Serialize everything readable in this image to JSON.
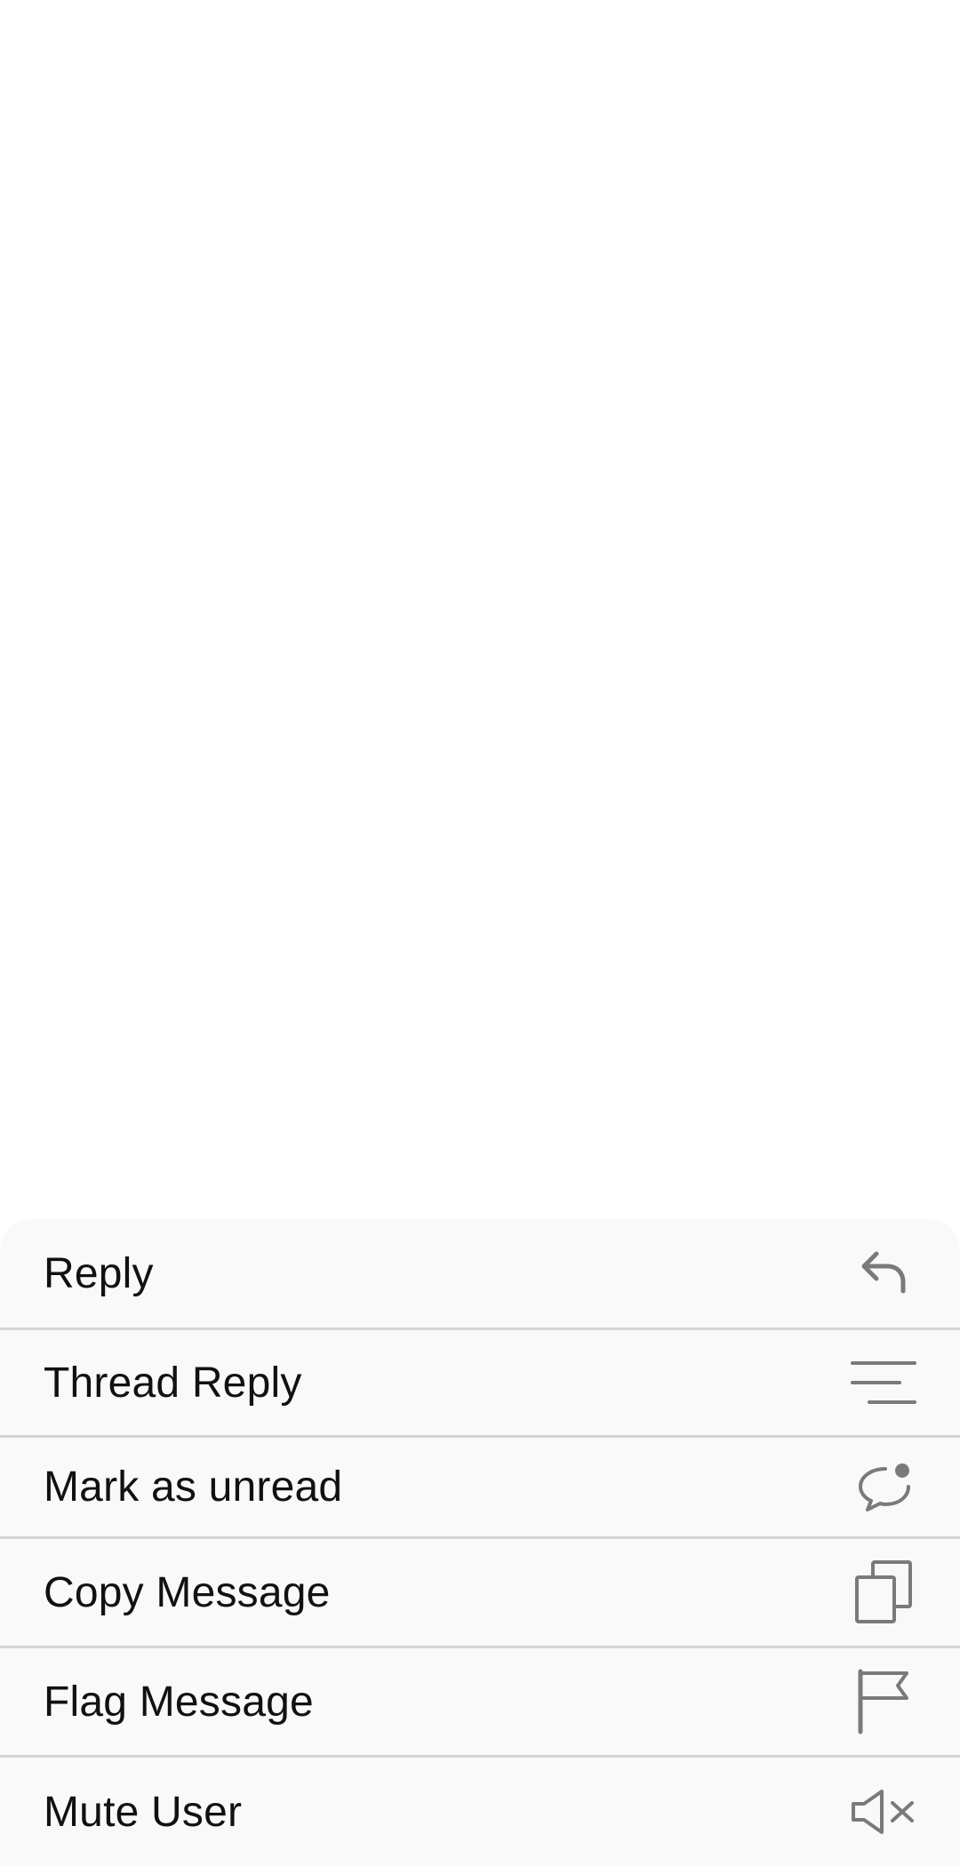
{
  "action_sheet": {
    "items": [
      {
        "label": "Reply",
        "icon": "reply-icon"
      },
      {
        "label": "Thread Reply",
        "icon": "thread-reply-icon"
      },
      {
        "label": "Mark as unread",
        "icon": "mark-unread-icon"
      },
      {
        "label": "Copy Message",
        "icon": "copy-icon"
      },
      {
        "label": "Flag Message",
        "icon": "flag-icon"
      },
      {
        "label": "Mute User",
        "icon": "mute-icon"
      }
    ]
  },
  "colors": {
    "sheet_background": "#f9f9f9",
    "divider": "#d4d4d4",
    "label_text": "#111111",
    "icon_gray": "#7a7a7a"
  }
}
